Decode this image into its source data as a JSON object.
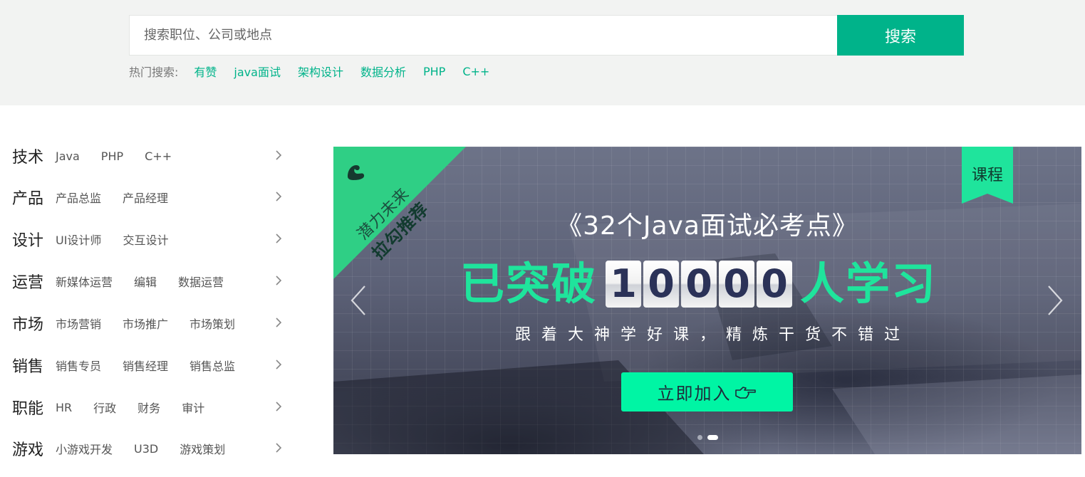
{
  "search": {
    "placeholder": "搜索职位、公司或地点",
    "button_label": "搜索",
    "hot_label": "热门搜索:",
    "hot_terms": [
      "有赞",
      "java面试",
      "架构设计",
      "数据分析",
      "PHP",
      "C++"
    ]
  },
  "categories": [
    {
      "title": "技术",
      "items": [
        "Java",
        "PHP",
        "C++"
      ]
    },
    {
      "title": "产品",
      "items": [
        "产品总监",
        "产品经理"
      ]
    },
    {
      "title": "设计",
      "items": [
        "UI设计师",
        "交互设计"
      ]
    },
    {
      "title": "运营",
      "items": [
        "新媒体运营",
        "编辑",
        "数据运营"
      ]
    },
    {
      "title": "市场",
      "items": [
        "市场营销",
        "市场推广",
        "市场策划"
      ]
    },
    {
      "title": "销售",
      "items": [
        "销售专员",
        "销售经理",
        "销售总监"
      ]
    },
    {
      "title": "职能",
      "items": [
        "HR",
        "行政",
        "财务",
        "审计"
      ]
    },
    {
      "title": "游戏",
      "items": [
        "小游戏开发",
        "U3D",
        "游戏策划"
      ]
    }
  ],
  "banner": {
    "ribbon_line1": "潜力未来",
    "ribbon_line2": "拉勾推荐",
    "tag": "课程",
    "title": "《32个Java面试必考点》",
    "headline_prefix": "已突破",
    "headline_number": "10000",
    "headline_suffix": "人学习",
    "subtitle": "跟着大神学好课，精炼干货不错过",
    "cta_label": "立即加入",
    "slide_count": 2,
    "active_slide": 2
  },
  "colors": {
    "accent": "#00b38a",
    "banner_green": "#1fe49c",
    "cta": "#00f5a4",
    "band_bg": "#f2f3f2"
  },
  "icons": {
    "category_arrow": "chevron-right-icon",
    "banner_prev": "chevron-left-icon",
    "banner_next": "chevron-right-icon",
    "cta": "pointing-hand-icon",
    "ribbon": "muscle-icon"
  }
}
